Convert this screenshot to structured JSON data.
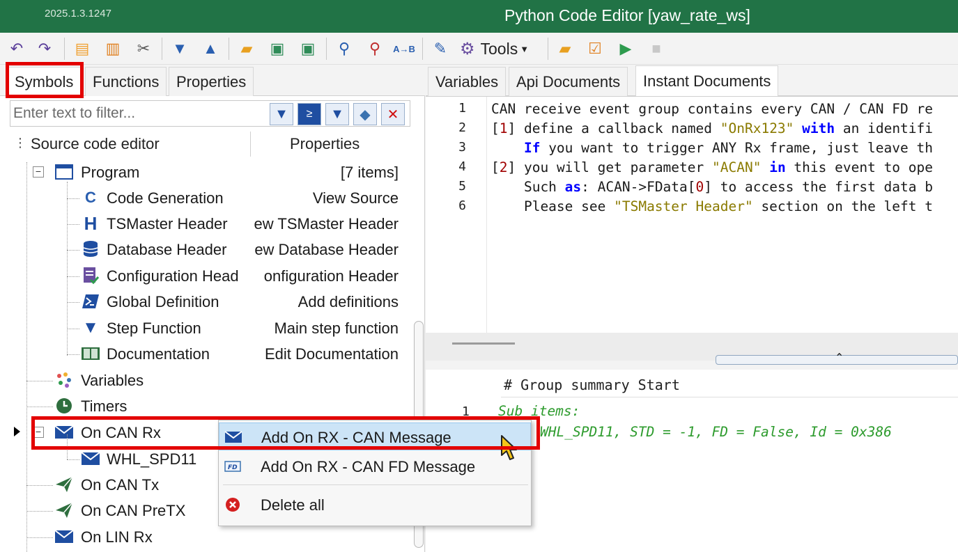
{
  "window": {
    "version": "2025.1.3.1247",
    "title": "Python Code Editor [yaw_rate_ws]"
  },
  "toolbar": {
    "tools_label": "Tools",
    "icons": [
      "undo-icon",
      "redo-icon",
      "copy-icon",
      "paste-icon",
      "cut-icon",
      "move-down-icon",
      "move-up-icon",
      "open-folder-icon",
      "save-icon",
      "save-all-icon",
      "find-icon",
      "find-replace-icon",
      "spell-check-icon",
      "edit-icon",
      "gear-icon",
      "folder-icon",
      "checklist-icon",
      "run-icon",
      "stop-icon"
    ]
  },
  "left_panel": {
    "tabs": [
      "Symbols",
      "Functions",
      "Properties"
    ],
    "active_tab": "Symbols",
    "filter_placeholder": "Enter text to filter...",
    "tree_header": {
      "col1": "Source code editor",
      "col2": "Properties"
    },
    "tree": {
      "program": {
        "label": "Program",
        "prop": "[7 items]"
      },
      "program_children": [
        {
          "label": "Code Generation",
          "prop": "View Source",
          "icon": "code-generation-icon"
        },
        {
          "label": "TSMaster Header",
          "prop": "ew TSMaster Header",
          "icon": "header-h-icon"
        },
        {
          "label": "Database Header",
          "prop": "ew Database Header",
          "icon": "database-icon"
        },
        {
          "label": "Configuration Head",
          "prop": "onfiguration Header",
          "icon": "configuration-icon"
        },
        {
          "label": "Global Definition",
          "prop": "Add definitions",
          "icon": "powershell-icon"
        },
        {
          "label": "Step Function",
          "prop": "Main step function",
          "icon": "step-triangle-icon"
        },
        {
          "label": "Documentation",
          "prop": "Edit Documentation",
          "icon": "book-icon"
        }
      ],
      "variables": "Variables",
      "timers": "Timers",
      "on_can_rx": "On CAN Rx",
      "whl_spd11": "WHL_SPD11",
      "on_can_tx": "On CAN Tx",
      "on_can_pretx": "On CAN PreTX",
      "on_lin_rx": "On LIN Rx"
    }
  },
  "right_panel": {
    "tabs": [
      "Variables",
      "Api Documents",
      "Instant Documents"
    ],
    "active_tab": "Instant Documents",
    "line_numbers": [
      "1",
      "2",
      "3",
      "4",
      "5",
      "6"
    ],
    "output_header": "# Group summary Start",
    "output_line_number": "1",
    "output_lines": [
      "Sub items:",
      "WHL_SPD11, STD = -1, FD = False, Id = 0x386"
    ]
  },
  "context_menu": {
    "items": [
      {
        "label": "Add On RX - CAN Message",
        "icon": "can-message-icon"
      },
      {
        "label": "Add On RX - CAN FD Message",
        "icon": "can-fd-icon"
      },
      {
        "label": "Delete all",
        "icon": "delete-icon"
      }
    ]
  },
  "colors": {
    "titlebar": "#217346",
    "highlight_box": "#e30000",
    "menu_hover": "#cce4f7",
    "keyword": "#0000ff",
    "string": "#8a7a00",
    "comment": "#2d9b2d"
  }
}
